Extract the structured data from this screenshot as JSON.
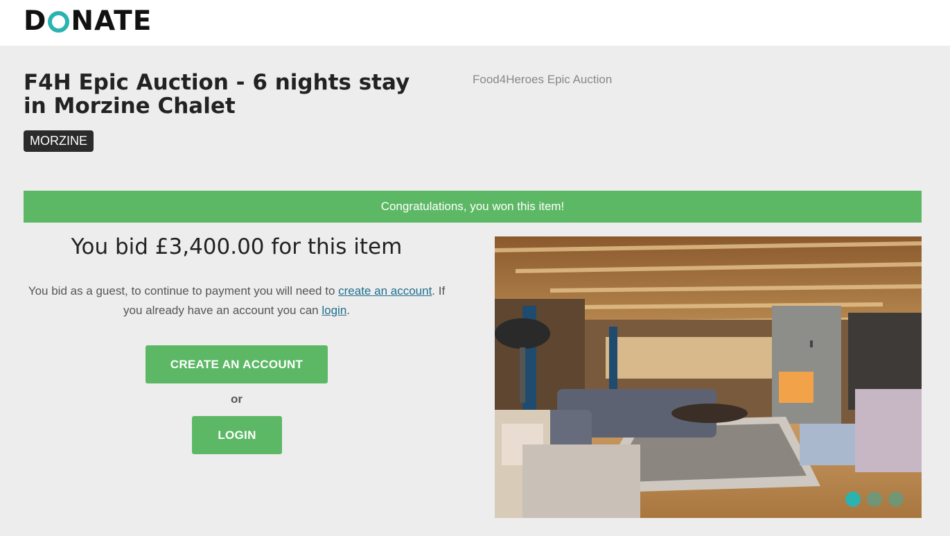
{
  "header": {
    "logo_before": "D",
    "logo_after": "NATE",
    "logo_accent": "#2bb3b1"
  },
  "item": {
    "title": "F4H Epic Auction - 6 nights stay in Morzine Chalet",
    "auction_name": "Food4Heroes Epic Auction",
    "location": "MORZINE"
  },
  "status": {
    "banner": "Congratulations, you won this item!",
    "banner_color": "#5cb865",
    "bid_heading": "You bid £3,400.00 for this item"
  },
  "guest": {
    "text_1": "You bid as a guest, to continue to payment you will need to ",
    "create_link": "create an account",
    "text_2": ". If you already have an account you can ",
    "login_link": "login",
    "text_3": "."
  },
  "actions": {
    "create_account_label": "CREATE AN ACCOUNT",
    "or_label": "or",
    "login_label": "LOGIN"
  },
  "carousel": {
    "image_description": "chalet-living-room-photo",
    "slide_count": 3,
    "active_slide": 1
  }
}
